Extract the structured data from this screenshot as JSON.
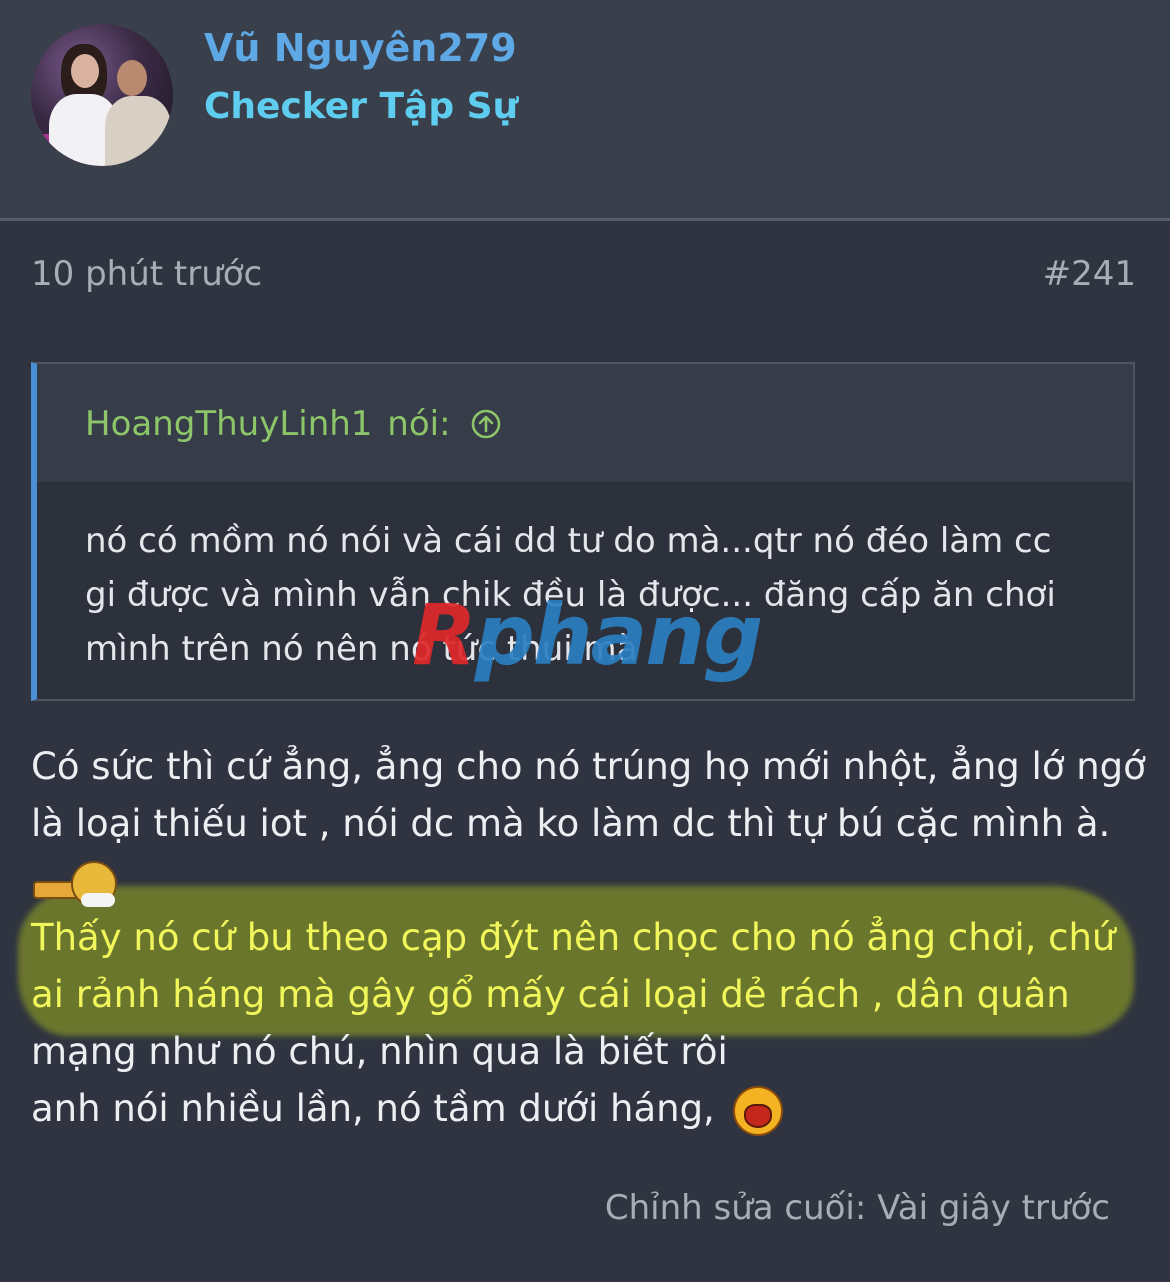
{
  "user": {
    "name": "Vũ Nguyên279",
    "title": "Checker Tập Sự"
  },
  "post": {
    "time": "10 phút trước",
    "number": "#241",
    "quote": {
      "author": "HoangThuyLinh1",
      "author_suffix": "nói:",
      "lines": [
        "nó có mồm nó nói và cái dd tư do mà...qtr nó đéo làm cc",
        "gi được và mình vẫn chik đều là được... đăng cấp ăn chơi",
        "mình trên nó nên nó tức thui mà"
      ]
    },
    "message": {
      "lines": [
        "Có sức thì cứ ẳng, ẳng cho nó trúng họ mới nhột, ẳng lớ ngớ",
        "là loại thiếu iot , nói dc mà ko làm dc thì tự bú cặc mình à.",
        "Thấy nó cứ bu theo cạp đýt nên chọc cho nó ẳng chơi, chứ",
        "ai rảnh háng mà gây gổ mấy cái loại dẻ rách , dân quân",
        "mạng như nó chú, nhìn qua là biết rôi",
        "anh nói nhiều lần, nó tầm dưới háng,"
      ],
      "emojis": [
        "smoking-smiley-icon",
        "shouting-smiley-icon"
      ]
    },
    "edited": "Chỉnh sửa cuối: Vài giây trước"
  },
  "watermark": {
    "part1": "R",
    "part2": "phang"
  },
  "colors": {
    "background": "#2f3440",
    "header_background": "#3a404b",
    "username": "#5fa8e6",
    "user_title": "#5ecdf0",
    "quote_author": "#8cc56a",
    "quote_border": "#4a90d9",
    "highlight_text": "#f1f65a",
    "highlight_marker": "#bed214"
  }
}
